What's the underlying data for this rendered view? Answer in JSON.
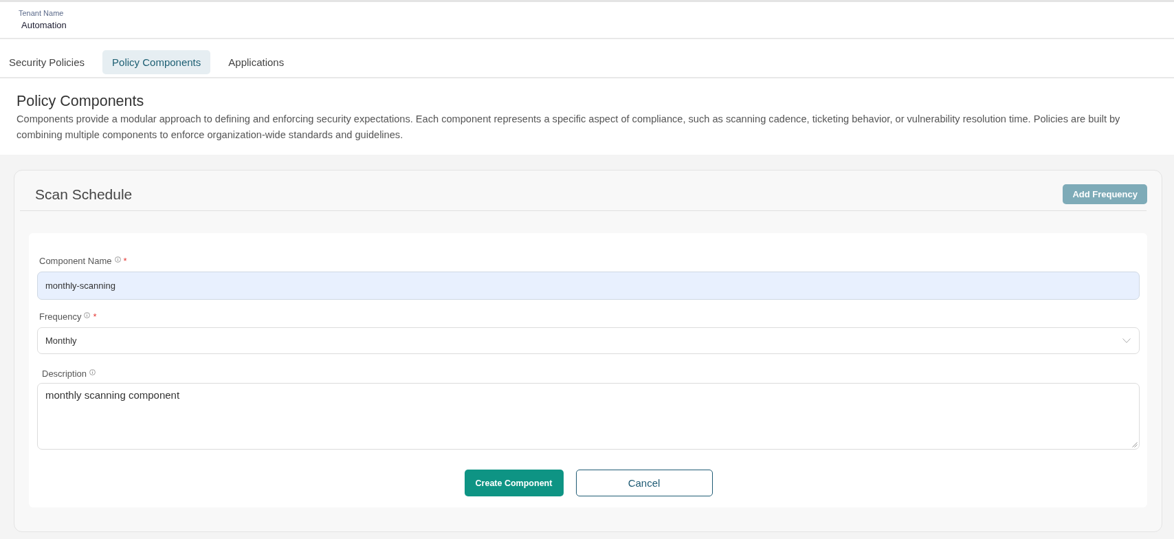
{
  "header": {
    "tenant_label": "Tenant Name",
    "tenant_name": "Automation"
  },
  "tabs": [
    {
      "label": "Security Policies",
      "selected": false
    },
    {
      "label": "Policy Components",
      "selected": true
    },
    {
      "label": "Applications",
      "selected": false
    }
  ],
  "page": {
    "title": "Policy Components",
    "description": "Components provide a modular approach to defining and enforcing security expectations. Each component represents a specific aspect of compliance, such as scanning cadence, ticketing behavior, or vulnerability resolution time. Policies are built by combining multiple components to enforce organization-wide standards and guidelines."
  },
  "card": {
    "title": "Scan Schedule",
    "add_button": "Add Frequency",
    "fields": [
      {
        "kind": "text",
        "label": "Component Name",
        "required_mark": "*",
        "value": "monthly-scanning"
      },
      {
        "kind": "select",
        "label": "Frequency",
        "required_mark": "*",
        "value": "Monthly"
      },
      {
        "kind": "textarea",
        "label": "Description",
        "value": "monthly scanning component"
      }
    ],
    "buttons": [
      {
        "kind": "primary",
        "label": "Create Component"
      },
      {
        "kind": "secondary",
        "label": "Cancel"
      }
    ]
  }
}
